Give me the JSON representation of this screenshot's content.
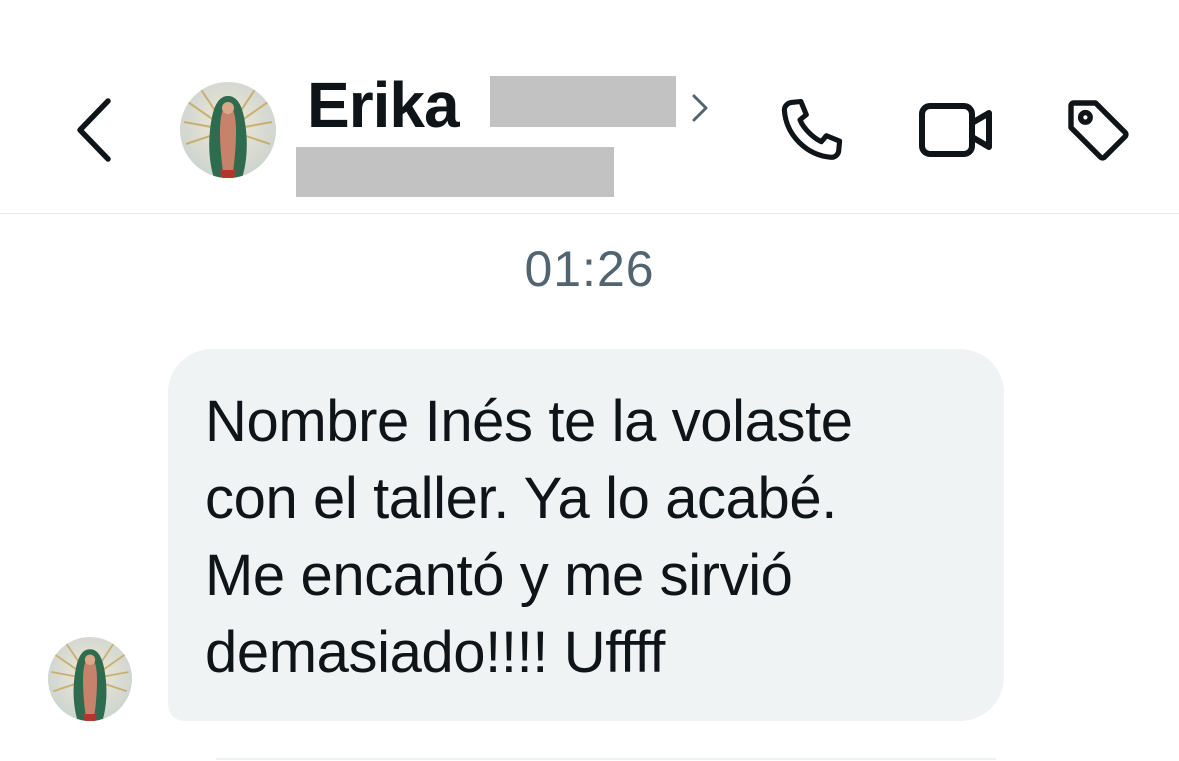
{
  "header": {
    "contact_name": "Erika",
    "icons": {
      "back": "chevron-left-icon",
      "profile": "chevron-right-icon",
      "call": "phone-icon",
      "video": "video-camera-icon",
      "label": "tag-icon"
    }
  },
  "conversation": {
    "timestamp": "01:26",
    "messages": [
      {
        "direction": "incoming",
        "text": "Nombre Inés te la volaste\ncon el taller. Ya lo acabé.\nMe encantó y me sirvió\ndemasiado!!!! Uffff"
      }
    ]
  },
  "colors": {
    "text_primary": "#0f1419",
    "text_secondary": "#536471",
    "bubble_incoming": "#eff3f4",
    "redaction": "#c2c2c2"
  }
}
